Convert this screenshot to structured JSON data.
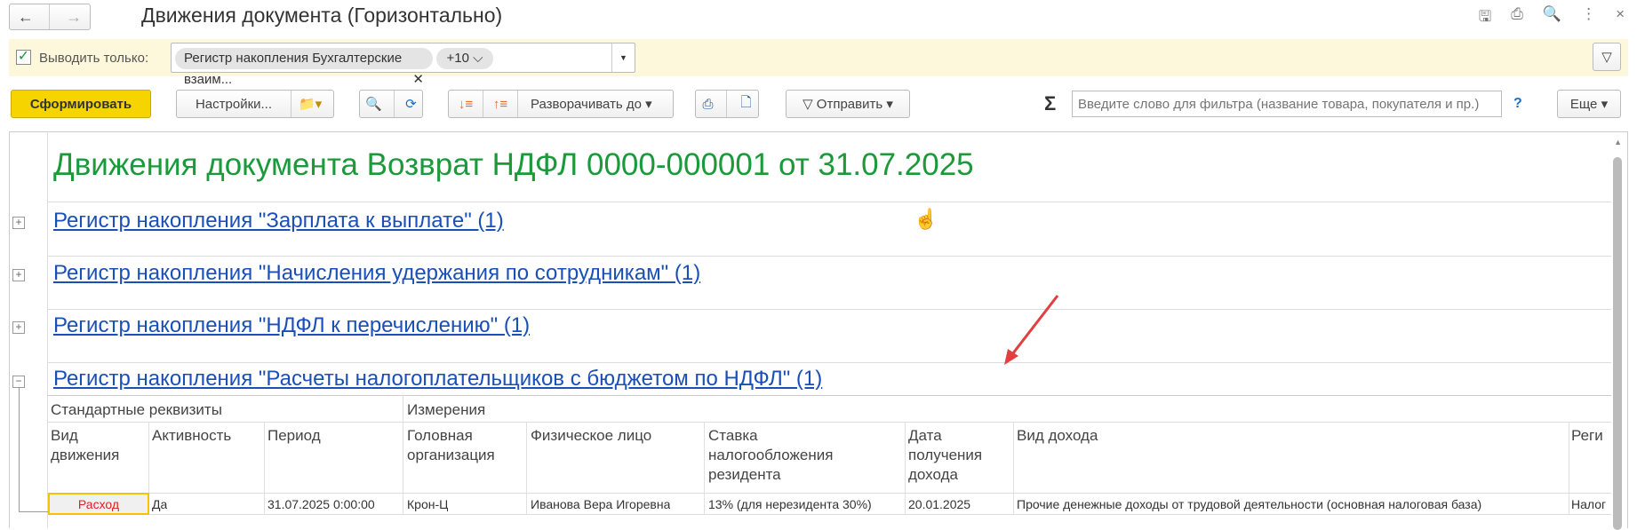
{
  "window": {
    "title": "Движения документа (Горизонтально)"
  },
  "filter": {
    "label": "Выводить только:",
    "tag": "Регистр накопления Бухгалтерские взаим...",
    "more": "+10"
  },
  "toolbar": {
    "generate": "Сформировать",
    "settings": "Настройки...",
    "expand": "Разворачивать до",
    "send": "Отправить",
    "search_placeholder": "Введите слово для фильтра (название товара, покупателя и пр.)",
    "help": "?",
    "more": "Еще",
    "sigma": "Σ"
  },
  "report": {
    "heading": "Движения документа Возврат НДФЛ 0000-000001 от 31.07.2025",
    "registers": [
      "Регистр накопления \"Зарплата к выплате\" (1)",
      "Регистр накопления \"Начисления удержания по сотрудникам\" (1)",
      "Регистр накопления \"НДФЛ к перечислению\" (1)",
      "Регистр накопления \"Расчеты налогоплательщиков с бюджетом по НДФЛ\" (1)"
    ],
    "groups": [
      "Стандартные реквизиты",
      "Измерения"
    ],
    "columns": [
      "Вид движения",
      "Активность",
      "Период",
      "Головная организация",
      "Физическое лицо",
      "Ставка налогообложения резидента",
      "Дата получения дохода",
      "Вид дохода",
      "Реги"
    ],
    "row": [
      "Расход",
      "Да",
      "31.07.2025 0:00:00",
      "Крон-Ц",
      "Иванова Вера Игоревна",
      "13% (для нерезидента 30%)",
      "20.01.2025",
      "Прочие денежные доходы от трудовой деятельности (основная налоговая база)",
      "Налог"
    ]
  },
  "colors": {
    "accent": "#f5d400",
    "heading": "#1a9a3a",
    "link": "#1a4fb8",
    "expense": "#e02020"
  }
}
